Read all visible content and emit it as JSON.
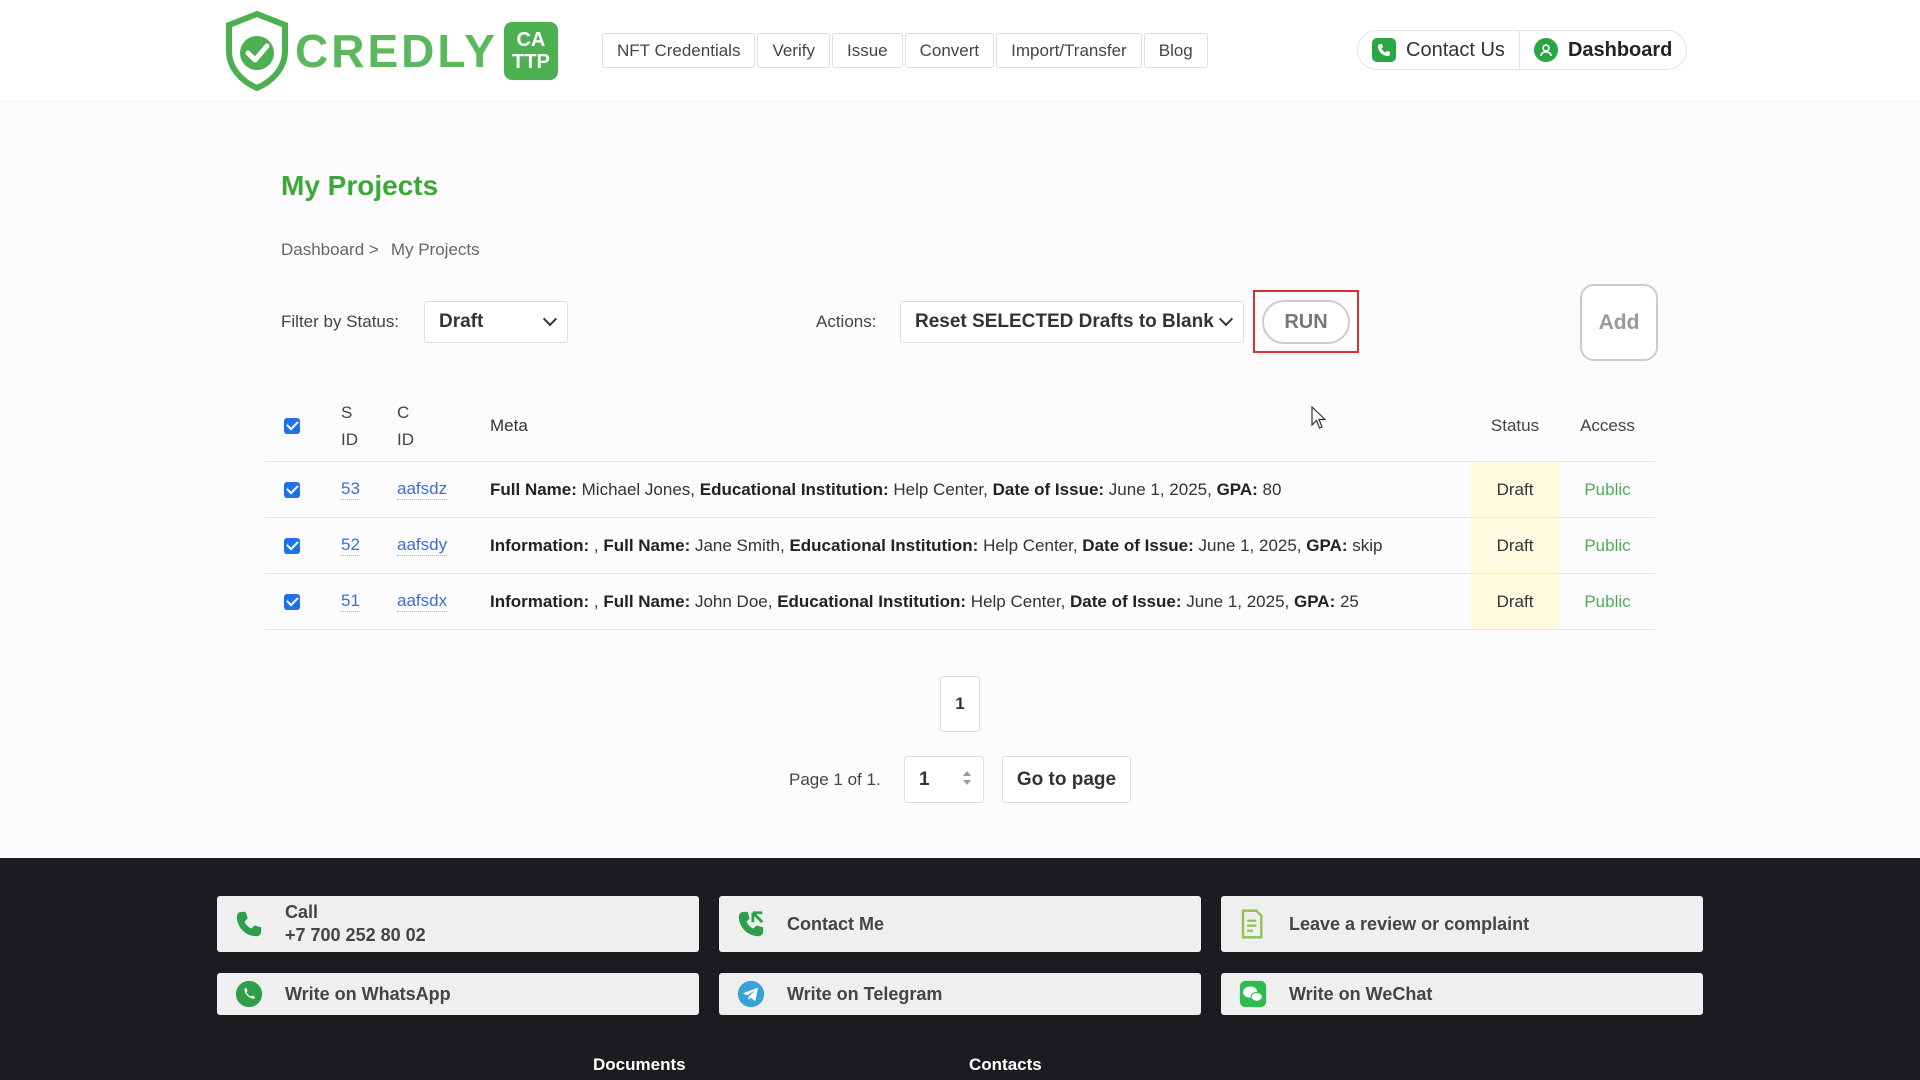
{
  "brand": {
    "name": "CREDLY",
    "tag_line1": "CA",
    "tag_line2": "TTP",
    "color": "#5cb85c"
  },
  "nav": [
    {
      "label": "NFT Credentials"
    },
    {
      "label": "Verify"
    },
    {
      "label": "Issue"
    },
    {
      "label": "Convert"
    },
    {
      "label": "Import/Transfer"
    },
    {
      "label": "Blog"
    }
  ],
  "header_right": {
    "contact_label": "Contact Us",
    "dashboard_label": "Dashboard"
  },
  "page": {
    "title": "My Projects"
  },
  "breadcrumb": {
    "root": "Dashboard >",
    "current": "My Projects"
  },
  "filter": {
    "label": "Filter by Status:",
    "value": "Draft"
  },
  "actions": {
    "label": "Actions:",
    "value": "Reset SELECTED Drafts to Blank",
    "run_label": "RUN",
    "add_label": "Add"
  },
  "table": {
    "headers": {
      "sid_1": "S",
      "sid_2": "ID",
      "cid_1": "C",
      "cid_2": "ID",
      "meta": "Meta",
      "status": "Status",
      "access": "Access"
    },
    "rows": [
      {
        "sid": "53",
        "cid": "aafsdz",
        "meta": [
          {
            "k": "Full Name:",
            "v": " Michael Jones, "
          },
          {
            "k": "Educational Institution:",
            "v": " Help Center, "
          },
          {
            "k": "Date of Issue:",
            "v": " June 1, 2025, "
          },
          {
            "k": "GPA:",
            "v": " 80"
          }
        ],
        "status": "Draft",
        "access": "Public",
        "checked": true
      },
      {
        "sid": "52",
        "cid": "aafsdy",
        "meta": [
          {
            "k": "Information:",
            "v": " , "
          },
          {
            "k": "Full Name:",
            "v": " Jane Smith, "
          },
          {
            "k": "Educational Institution:",
            "v": " Help Center, "
          },
          {
            "k": "Date of Issue:",
            "v": " June 1, 2025, "
          },
          {
            "k": "GPA:",
            "v": " skip"
          }
        ],
        "status": "Draft",
        "access": "Public",
        "checked": true
      },
      {
        "sid": "51",
        "cid": "aafsdx",
        "meta": [
          {
            "k": "Information:",
            "v": " , "
          },
          {
            "k": "Full Name:",
            "v": " John Doe, "
          },
          {
            "k": "Educational Institution:",
            "v": " Help Center, "
          },
          {
            "k": "Date of Issue:",
            "v": " June 1, 2025, "
          },
          {
            "k": "GPA:",
            "v": " 25"
          }
        ],
        "status": "Draft",
        "access": "Public",
        "checked": true
      }
    ]
  },
  "pagination": {
    "current": "1",
    "info": "Page 1 of 1.",
    "input_value": "1",
    "go_label": "Go to page"
  },
  "footer": {
    "call_label": "Call",
    "call_number": "+7 700 252 80 02",
    "contact_me": "Contact Me",
    "review": "Leave a review or complaint",
    "whatsapp": "Write on WhatsApp",
    "telegram": "Write on Telegram",
    "wechat": "Write on WeChat",
    "documents": "Documents",
    "contacts": "Contacts"
  },
  "colors": {
    "accent_green": "#3aa935",
    "link_blue": "#3a6fd8",
    "status_bg": "#fffbe0",
    "highlight_red": "#d63031",
    "footer_bg": "#1c1b1f"
  }
}
